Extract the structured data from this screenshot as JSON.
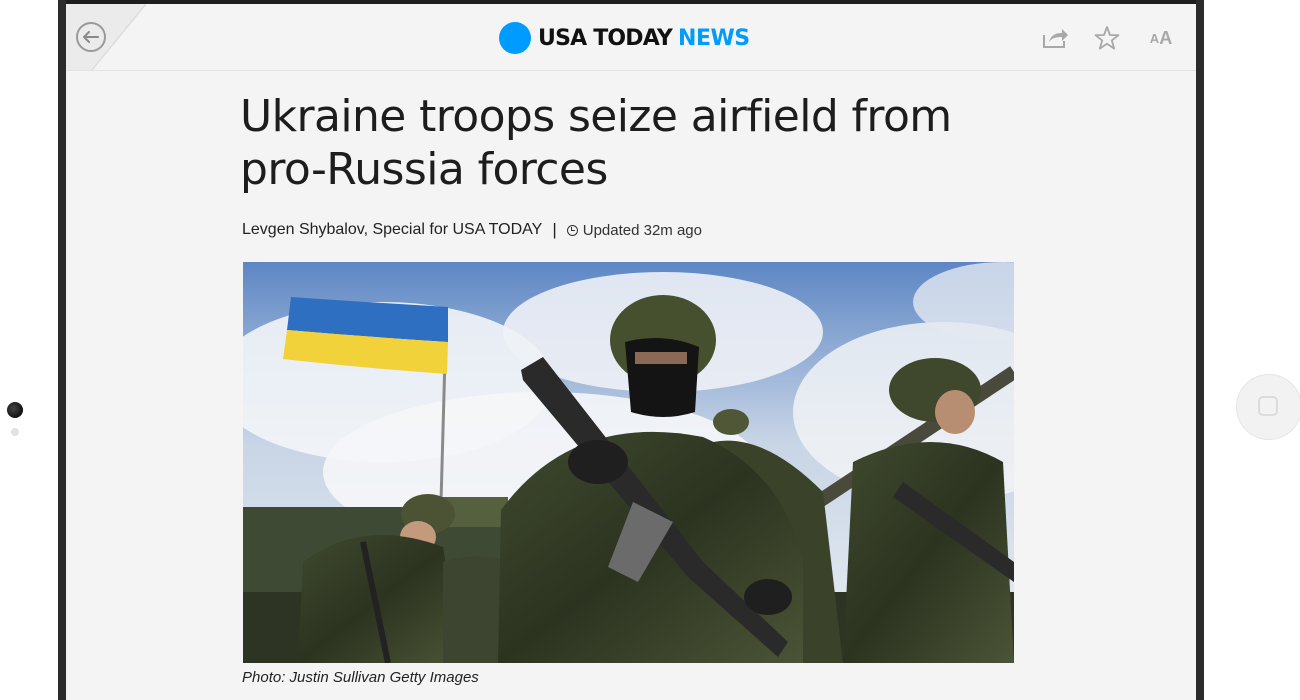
{
  "header": {
    "brand_name": "USA TODAY",
    "brand_section": "NEWS",
    "brand_color": "#009bff",
    "back_icon": "back-arrow-icon",
    "share_icon": "share-icon",
    "favorite_icon": "star-icon",
    "text_size_small": "A",
    "text_size_large": "A"
  },
  "article": {
    "headline": "Ukraine troops seize airfield from pro-Russia forces",
    "author": "Levgen Shybalov, Special for USA TODAY",
    "separator": "|",
    "updated": "Updated 32m ago",
    "photo_caption": "Photo: Justin Sullivan Getty Images"
  }
}
